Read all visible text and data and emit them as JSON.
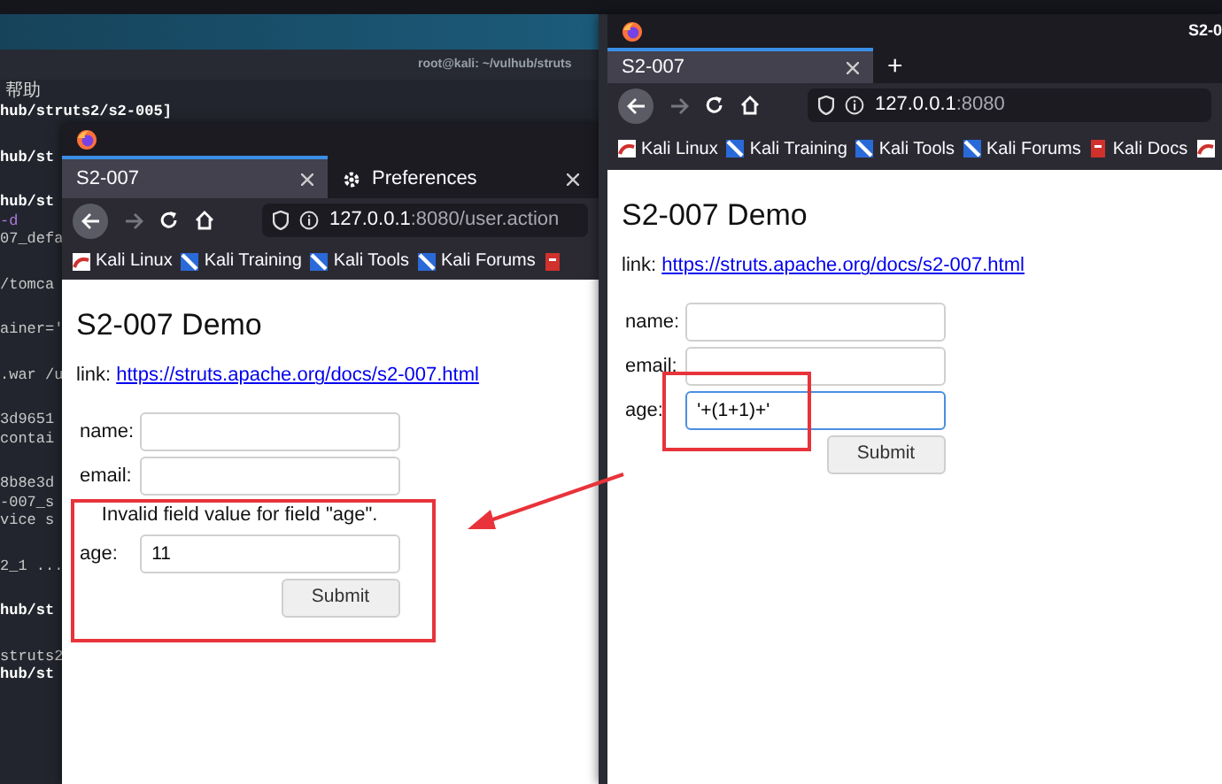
{
  "terminal": {
    "title": "root@kali: ~/vulhub/struts",
    "menu": "帮助",
    "blocks": [
      [
        {
          "text": "hub/struts2/s2-005]",
          "kind": "prompt"
        }
      ],
      [
        {
          "text": "hub/st",
          "kind": "prompt"
        }
      ],
      [
        {
          "text": "hub/st",
          "kind": "prompt"
        },
        {
          "text": "-d",
          "kind": "flag"
        },
        {
          "text": "07_defa",
          "kind": "output"
        }
      ],
      [
        {
          "text": "/tomca",
          "kind": "output"
        }
      ],
      [
        {
          "text": "ainer='",
          "kind": "output"
        }
      ],
      [
        {
          "text": ".war /u",
          "kind": "output"
        }
      ],
      [
        {
          "text": "3d9651",
          "kind": "output"
        },
        {
          "text": "contai",
          "kind": "output"
        }
      ],
      [
        {
          "text": "8b8e3d",
          "kind": "output"
        },
        {
          "text": "-007_s",
          "kind": "output"
        },
        {
          "text": "vice s",
          "kind": "output"
        }
      ],
      [
        {
          "text": "2_1 ...",
          "kind": "output"
        }
      ],
      [
        {
          "text": "hub/st",
          "kind": "prompt"
        }
      ],
      [
        {
          "text": "struts2",
          "kind": "output"
        },
        {
          "text": "hub/st",
          "kind": "prompt"
        }
      ]
    ]
  },
  "windows": [
    {
      "tabs": [
        {
          "label": "S2-007",
          "selected": true,
          "kind": "page"
        },
        {
          "label": "Preferences",
          "selected": false,
          "kind": "settings"
        }
      ],
      "url": {
        "host": "127.0.0.1",
        "rest": ":8080/user.action"
      },
      "bookmarks": [
        {
          "label": "Kali Linux",
          "kind": "kali"
        },
        {
          "label": "Kali Training",
          "kind": "tool"
        },
        {
          "label": "Kali Tools",
          "kind": "tool"
        },
        {
          "label": "Kali Forums",
          "kind": "tool"
        },
        {
          "kind": "docs"
        }
      ],
      "page": {
        "heading": "S2-007 Demo",
        "link_prefix": "link:",
        "link": "https://struts.apache.org/docs/s2-007.html",
        "fields": [
          {
            "label": "name:",
            "focused": false
          },
          {
            "label": "email:",
            "focused": false
          },
          {
            "label": "age:",
            "value": "11",
            "focused": false,
            "error": "Invalid field value for field \"age\"."
          }
        ],
        "submit": "Submit"
      }
    },
    {
      "title": "S2-0",
      "tabs": [
        {
          "label": "S2-007",
          "selected": true,
          "kind": "page"
        }
      ],
      "new_tab": "+",
      "url": {
        "host": "127.0.0.1",
        "rest": ":8080"
      },
      "bookmarks": [
        {
          "label": "Kali Linux",
          "kind": "kali"
        },
        {
          "label": "Kali Training",
          "kind": "tool"
        },
        {
          "label": "Kali Tools",
          "kind": "tool"
        },
        {
          "label": "Kali Forums",
          "kind": "tool"
        },
        {
          "label": "Kali Docs",
          "kind": "docs"
        },
        {
          "kind": "kali"
        }
      ],
      "page": {
        "heading": "S2-007 Demo",
        "link_prefix": "link:",
        "link": "https://struts.apache.org/docs/s2-007.html",
        "fields": [
          {
            "label": "name:",
            "focused": false
          },
          {
            "label": "email:",
            "focused": false
          },
          {
            "label": "age:",
            "value": "'+(1+1)+'",
            "focused": true
          }
        ],
        "submit": "Submit"
      }
    }
  ]
}
